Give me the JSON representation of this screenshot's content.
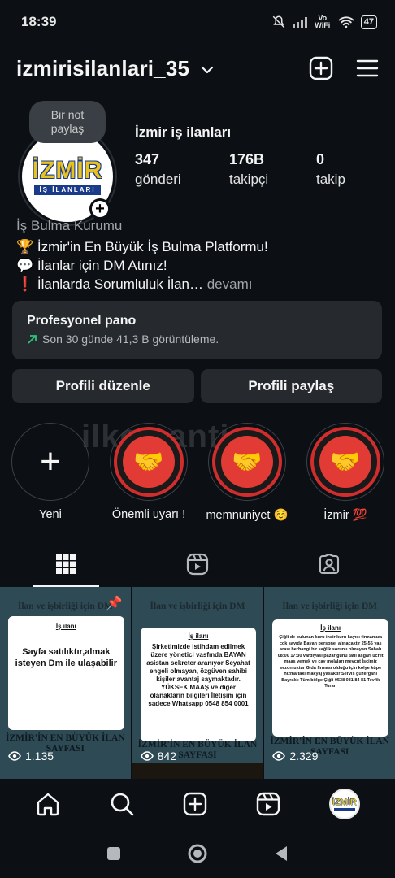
{
  "status_bar": {
    "time": "18:39",
    "network_label": "Vo WiFi",
    "battery": "47"
  },
  "header": {
    "username": "izmirisilanlari_35"
  },
  "profile": {
    "note": "Bir not paylaş",
    "display_name": "İzmir iş ilanları",
    "logo_main": "İZMİR",
    "logo_sub": "İŞ İLANLARI",
    "stats": [
      {
        "value": "347",
        "label": "gönderi"
      },
      {
        "value": "176B",
        "label": "takipçi"
      },
      {
        "value": "0",
        "label": "takip"
      }
    ],
    "category": "İş Bulma Kurumu",
    "bio": [
      "🏆 İzmir'in En Büyük İş Bulma Platformu!",
      "💬 İlanlar için DM Atınız!",
      "❗ İlanlarda Sorumluluk İlan…"
    ],
    "bio_more": " devamı"
  },
  "dashboard": {
    "title": "Profesyonel pano",
    "subtitle": "Son 30 günde 41,3 B görüntüleme."
  },
  "buttons": {
    "edit": "Profili düzenle",
    "share": "Profili paylaş"
  },
  "highlights": [
    {
      "label": "Yeni",
      "type": "new"
    },
    {
      "label": "Önemli uyarı !",
      "type": "story"
    },
    {
      "label": "memnuniyet ☺️",
      "type": "story"
    },
    {
      "label": "İzmir 💯",
      "type": "story"
    }
  ],
  "watermark": "ilkemantis",
  "posts": [
    {
      "header": "İlan ve işbirliği için DM",
      "card_title": "İş ilanı",
      "card_body": "Sayfa satılıktır,almak isteyen Dm ile ulaşabilir",
      "footer": "İZMİR'İN EN BÜYÜK İLAN SAYFASI",
      "views": "1.135",
      "pinned": true
    },
    {
      "header": "İlan ve işbirliği için DM",
      "card_title": "İş ilanı",
      "card_body": "Şirketimizde istihdam edilmek üzere yönetici vasfında BAYAN asistan sekreter aranıyor Seyahat engeli olmayan, özgüven sahibi kişiler avantaj saymaktadır. YÜKSEK MAAŞ ve diğer olanakların bilgileri İletişim için sadece Whatsapp 0548 854 0001",
      "footer": "İZMİR'İN EN BÜYÜK İLAN SAYFASI",
      "views": "842",
      "pinned": false
    },
    {
      "header": "İlan ve işbirliği için DM",
      "card_title": "İş ilanı",
      "card_body": "Çiğli de bulunan kuru incir kuru kayısı firmamıza çok sayıda Bayan personel alınacaktır 25-55 yaş arası herhangi bir sağlık sorunu olmayan Sabah 08:00 17:30 vardiyası pazar günü tatil asgari ücret maaş yemek ve çay molaları mevcut İşçimiz sezonluktur Gıda firması olduğu için kolye küpe hızma takı makyaj yasaktır Servis güzergahı Bayraklı Tüm bölge Çiğli 0538 031 84 81 Tevfik Turan",
      "footer": "İZMİR'İN EN BÜYÜK İLAN SAYFASI",
      "views": "2.329",
      "pinned": false
    }
  ]
}
